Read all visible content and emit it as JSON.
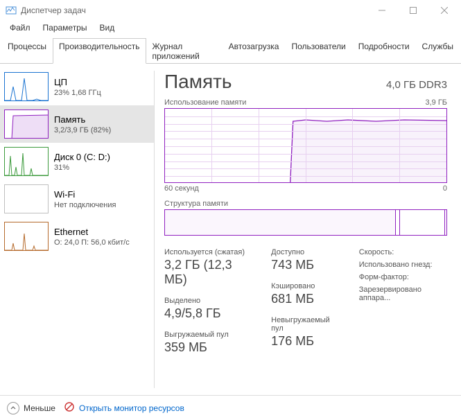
{
  "window": {
    "title": "Диспетчер задач"
  },
  "menu": {
    "file": "Файл",
    "options": "Параметры",
    "view": "Вид"
  },
  "tabs": {
    "processes": "Процессы",
    "performance": "Производительность",
    "app_history": "Журнал приложений",
    "startup": "Автозагрузка",
    "users": "Пользователи",
    "details": "Подробности",
    "services": "Службы"
  },
  "sidebar": {
    "cpu": {
      "name": "ЦП",
      "sub": "23% 1,68 ГГц",
      "color": "#1a73d1"
    },
    "memory": {
      "name": "Память",
      "sub": "3,2/3,9 ГБ (82%)",
      "color": "#9020c0"
    },
    "disk": {
      "name": "Диск 0 (C: D:)",
      "sub": "31%",
      "color": "#3c9a3c"
    },
    "wifi": {
      "name": "Wi-Fi",
      "sub": "Нет подключения",
      "color": "#bfbfbf"
    },
    "ethernet": {
      "name": "Ethernet",
      "sub": "О: 24,0 П: 56,0 кбит/с",
      "color": "#b56a2b"
    }
  },
  "main": {
    "title": "Память",
    "capacity": "4,0 ГБ DDR3",
    "usage_label": "Использование памяти",
    "usage_max": "3,9 ГБ",
    "axis_left": "60 секунд",
    "axis_right": "0",
    "composition_label": "Структура памяти",
    "stats": {
      "in_use_label": "Используется (сжатая)",
      "in_use_val": "3,2 ГБ (12,3 МБ)",
      "available_label": "Доступно",
      "available_val": "743 МБ",
      "committed_label": "Выделено",
      "committed_val": "4,9/5,8 ГБ",
      "cached_label": "Кэшировано",
      "cached_val": "681 МБ",
      "paged_label": "Выгружаемый пул",
      "paged_val": "359 МБ",
      "nonpaged_label": "Невыгружаемый пул",
      "nonpaged_val": "176 МБ"
    },
    "meta": {
      "speed": "Скорость:",
      "slots": "Использовано гнезд:",
      "form": "Форм-фактор:",
      "reserved": "Зарезервировано аппара..."
    }
  },
  "footer": {
    "fewer": "Меньше",
    "resource_monitor": "Открыть монитор ресурсов"
  },
  "chart_data": {
    "type": "area",
    "title": "Использование памяти",
    "xlabel": "60 секунд → 0",
    "ylabel": "ГБ",
    "ylim": [
      0,
      3.9
    ],
    "x": [
      0,
      5,
      10,
      15,
      20,
      25,
      27,
      28,
      30,
      35,
      40,
      45,
      50,
      55,
      60
    ],
    "values": [
      0.02,
      0.02,
      0.02,
      0.02,
      0.02,
      0.02,
      0.02,
      3.25,
      3.3,
      3.25,
      3.3,
      3.25,
      3.3,
      3.28,
      3.3
    ],
    "composition_segments_gb": {
      "in_use": 3.2,
      "modified": 0.06,
      "standby": 0.62,
      "free": 0.02
    }
  }
}
